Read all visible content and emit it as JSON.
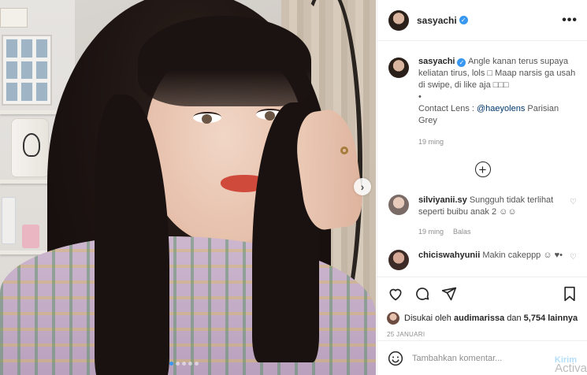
{
  "post": {
    "author": "sasyachi",
    "more_icon": "more-horizontal-icon",
    "next_icon": "chevron-right-icon",
    "carousel_count": 5,
    "carousel_active": 0
  },
  "caption": {
    "username": "sasyachi",
    "text_1": "Angle kanan terus supaya keliatan tirus, lols □ Maap narsis ga usah di swipe, di like aja □□□",
    "dot": "•",
    "contact_prefix": "Contact Lens : ",
    "contact_link": "@haeyolens",
    "contact_suffix": " Parisian Grey",
    "time": "19 ming"
  },
  "comments": [
    {
      "username": "silviyanii.sy",
      "text": "Sungguh tidak terlihat seperti buibu anak 2 ☺☺",
      "time": "19 ming",
      "reply_label": "Balas"
    },
    {
      "username": "chiciswahyunii",
      "text": "Makin cakeppp ☺ ♥•"
    }
  ],
  "actions": {
    "likes_prefix": "Disukai oleh ",
    "likes_user": "audimarissa",
    "likes_mid": " dan ",
    "likes_count": "5,754 lainnya",
    "date": "25 JANUARI"
  },
  "composer": {
    "placeholder": "Tambahkan komentar...",
    "send_label": "Kirim"
  },
  "watermark": "Activa",
  "colors": {
    "accent": "#3897f0",
    "lips": "#cf4a3b",
    "link": "#00376b"
  }
}
